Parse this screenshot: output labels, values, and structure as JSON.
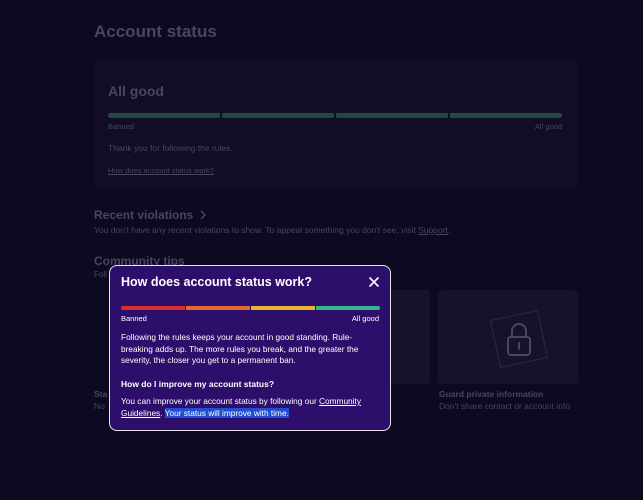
{
  "page": {
    "title": "Account status"
  },
  "status_card": {
    "heading": "All good",
    "bar_left_label": "Banned",
    "bar_right_label": "All good",
    "level_segments_filled": 4,
    "level_segments_total": 4,
    "message": "Thank you for following the rules.",
    "help_link": "How does account status work?"
  },
  "violations": {
    "heading": "Recent violations",
    "text_before_link": "You don't have any recent violations to show. To appeal something you don't see, visit ",
    "link": "Support",
    "text_after_link": "."
  },
  "tips": {
    "heading": "Community tips",
    "subtitle_visible": "Foll",
    "cards": [
      {
        "title": "Sta",
        "desc": "No"
      },
      {
        "title": "Guard private information",
        "desc": "Don't share contact or account info",
        "icon": "lock-icon"
      }
    ]
  },
  "modal": {
    "title": "How does account status work?",
    "close_icon": "close-icon",
    "bar_left_label": "Banned",
    "bar_right_label": "All good",
    "bar_colors": [
      "#d9302c",
      "#e36a2c",
      "#e9b430",
      "#38b58a"
    ],
    "paragraph": "Following the rules keeps your account in good standing. Rule-breaking adds up. The more rules you break, and the greater the severity, the closer you get to a permanent ban.",
    "subheading": "How do I improve my account status?",
    "improve_before_link": "You can improve your account status by following our ",
    "improve_link": "Community Guidelines",
    "improve_after_link": ". ",
    "improve_highlighted": "Your status will improve with time."
  },
  "colors": {
    "background": "#0c0920",
    "modal_background": "#2d0f6b",
    "dim_text": "#4a4560",
    "healthy_bar": "#1f4a3f",
    "selection_highlight": "#1f4fd0"
  }
}
